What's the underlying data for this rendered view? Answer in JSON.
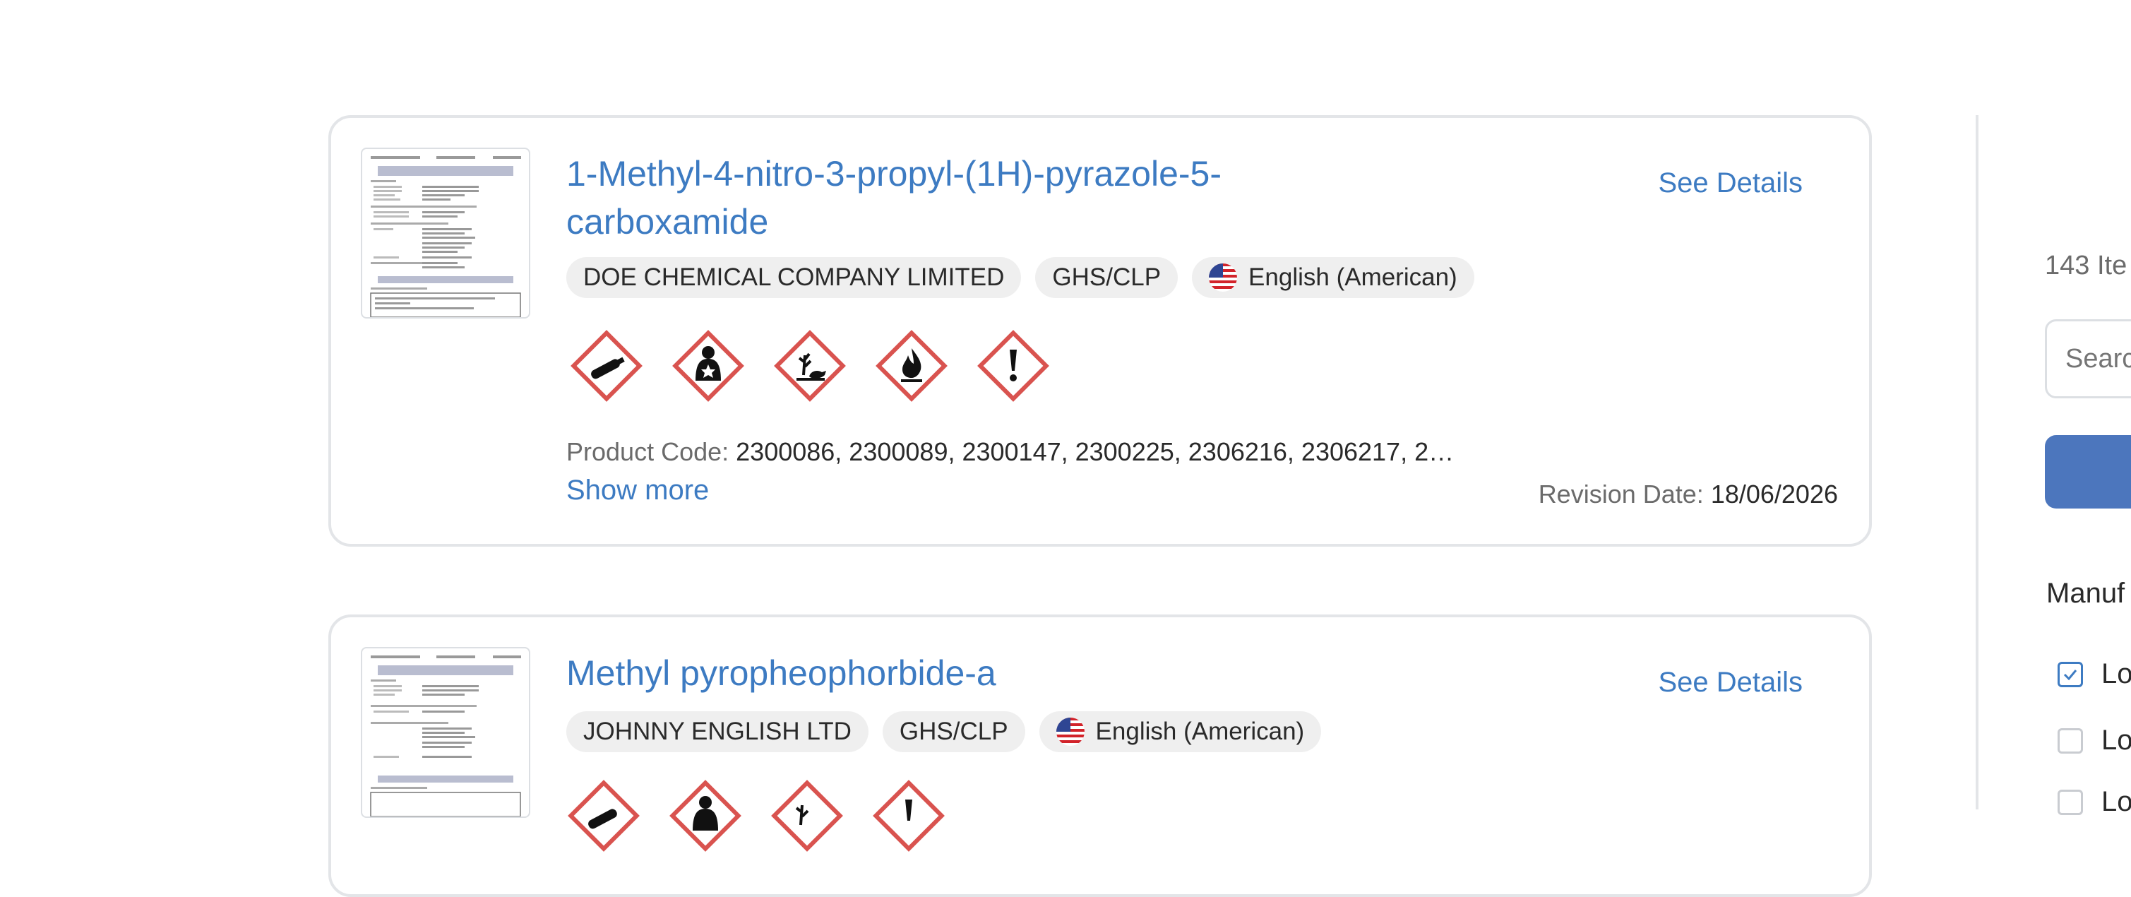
{
  "results": [
    {
      "title": "1-Methyl-4-nitro-3-propyl-(1H)-pyrazole-5-carboxamide",
      "see_details": "See Details",
      "manufacturer": "DOE CHEMICAL COMPANY LIMITED",
      "regulation": "GHS/CLP",
      "language": "English (American)",
      "pictograms": [
        "gas-cylinder-icon",
        "health-hazard-icon",
        "environment-icon",
        "flame-icon",
        "exclamation-icon"
      ],
      "product_code_label": "Product Code:",
      "product_code_value": "2300086, 2300089, 2300147, 2300225, 2306216, 2306217, 2…",
      "show_more": "Show more",
      "revision_label": "Revision Date:",
      "revision_value": "18/06/2026"
    },
    {
      "title": "Methyl pyropheophorbide-a",
      "see_details": "See Details",
      "manufacturer": "JOHNNY ENGLISH LTD",
      "regulation": "GHS/CLP",
      "language": "English (American)",
      "pictograms": [
        "gas-cylinder-icon",
        "health-hazard-icon",
        "environment-icon",
        "exclamation-icon"
      ]
    }
  ],
  "sidebar": {
    "items_count": "143 Ite",
    "search_placeholder": "Searc",
    "filter_heading": "Manuf",
    "filters": [
      {
        "label": "Lo",
        "checked": true
      },
      {
        "label": "Lo",
        "checked": false
      },
      {
        "label": "Lo",
        "checked": false
      }
    ]
  },
  "colors": {
    "accent": "#3d7bc2",
    "button": "#4c76bd",
    "pictogram_border": "#d9534f",
    "chip_bg": "#efefef"
  }
}
